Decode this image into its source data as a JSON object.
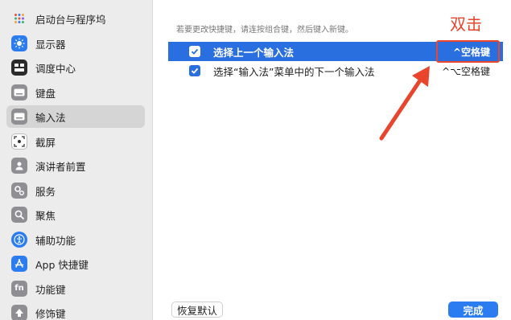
{
  "sidebar": {
    "items": [
      {
        "label": "启动台与程序坞",
        "icon": "grid-dots-icon",
        "color": "#6d6d6d"
      },
      {
        "label": "显示器",
        "icon": "sun-icon",
        "color": "#2a7cf0"
      },
      {
        "label": "调度中心",
        "icon": "mission-control-icon",
        "color": "#2b2b2b"
      },
      {
        "label": "键盘",
        "icon": "keyboard-icon",
        "color": "#8e8e93"
      },
      {
        "label": "输入法",
        "icon": "keyboard-icon",
        "color": "#8e8e93"
      },
      {
        "label": "截屏",
        "icon": "screenshot-icon",
        "color": "#ffffff"
      },
      {
        "label": "演讲者前置",
        "icon": "person-icon",
        "color": "#8e8e93"
      },
      {
        "label": "服务",
        "icon": "gears-icon",
        "color": "#8e8e93"
      },
      {
        "label": "聚焦",
        "icon": "magnifier-icon",
        "color": "#8e8e93"
      },
      {
        "label": "辅助功能",
        "icon": "accessibility-icon",
        "color": "#2a7cf0"
      },
      {
        "label": "App 快捷键",
        "icon": "app-store-icon",
        "color": "#2a7cf0"
      },
      {
        "label": "功能键",
        "icon": "fn-key-icon",
        "color": "#8e8e93"
      },
      {
        "label": "修饰键",
        "icon": "arrow-up-icon",
        "color": "#8e8e93"
      }
    ],
    "selected_index": 4
  },
  "main": {
    "hint": "若要更改快捷键，请连按组合键，然后键入新键。",
    "rows": [
      {
        "label": "选择上一个输入法",
        "shortcut": "^空格键",
        "checked": true,
        "selected": true
      },
      {
        "label": "选择“输入法”菜单中的下一个输入法",
        "shortcut": "^⌥空格键",
        "checked": true,
        "selected": false
      }
    ],
    "annotation": "双击",
    "restore_button": "恢复默认",
    "done_button": "完成"
  },
  "colors": {
    "accent": "#2a6fe0",
    "annotation": "#e8452c"
  }
}
